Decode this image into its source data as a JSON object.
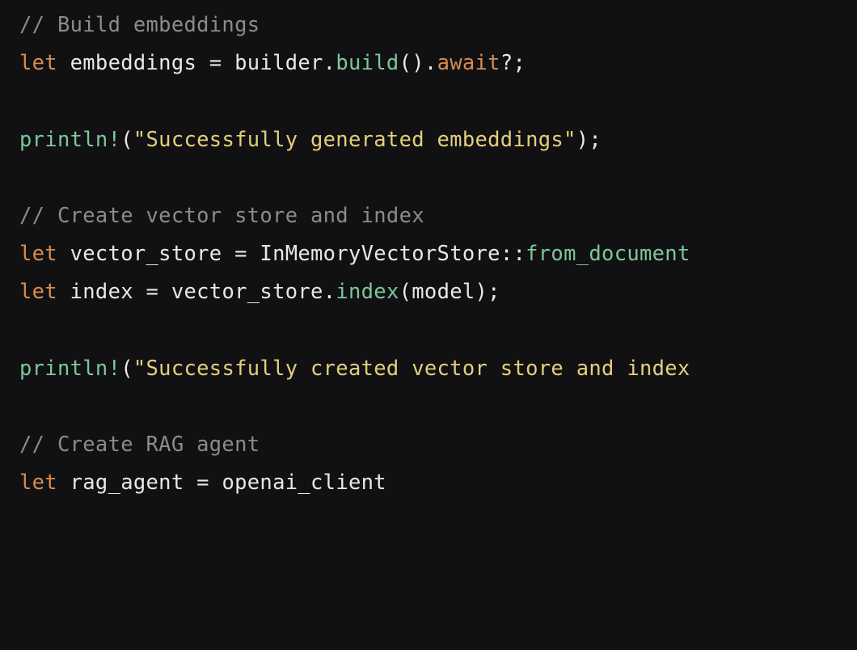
{
  "code": {
    "lines": [
      {
        "tokens": [
          {
            "cls": "tok-comment",
            "text": "// Build embeddings"
          }
        ]
      },
      {
        "tokens": [
          {
            "cls": "tok-keyword",
            "text": "let"
          },
          {
            "cls": "tok-ident",
            "text": " embeddings "
          },
          {
            "cls": "tok-op",
            "text": "="
          },
          {
            "cls": "tok-ident",
            "text": " builder"
          },
          {
            "cls": "tok-punct",
            "text": "."
          },
          {
            "cls": "tok-method",
            "text": "build"
          },
          {
            "cls": "tok-punct",
            "text": "()."
          },
          {
            "cls": "tok-keyword",
            "text": "await"
          },
          {
            "cls": "tok-punct",
            "text": "?;"
          }
        ]
      },
      {
        "tokens": [
          {
            "cls": "tok-ident",
            "text": ""
          }
        ]
      },
      {
        "tokens": [
          {
            "cls": "tok-macro",
            "text": "println!"
          },
          {
            "cls": "tok-punct",
            "text": "("
          },
          {
            "cls": "tok-string",
            "text": "\"Successfully generated embeddings\""
          },
          {
            "cls": "tok-punct",
            "text": ");"
          }
        ]
      },
      {
        "tokens": [
          {
            "cls": "tok-ident",
            "text": ""
          }
        ]
      },
      {
        "tokens": [
          {
            "cls": "tok-comment",
            "text": "// Create vector store and index"
          }
        ]
      },
      {
        "tokens": [
          {
            "cls": "tok-keyword",
            "text": "let"
          },
          {
            "cls": "tok-ident",
            "text": " vector_store "
          },
          {
            "cls": "tok-op",
            "text": "="
          },
          {
            "cls": "tok-type",
            "text": " InMemoryVectorStore"
          },
          {
            "cls": "tok-punct",
            "text": "::"
          },
          {
            "cls": "tok-path",
            "text": "from_document"
          }
        ]
      },
      {
        "tokens": [
          {
            "cls": "tok-keyword",
            "text": "let"
          },
          {
            "cls": "tok-ident",
            "text": " index "
          },
          {
            "cls": "tok-op",
            "text": "="
          },
          {
            "cls": "tok-ident",
            "text": " vector_store"
          },
          {
            "cls": "tok-punct",
            "text": "."
          },
          {
            "cls": "tok-method",
            "text": "index"
          },
          {
            "cls": "tok-punct",
            "text": "(model);"
          }
        ]
      },
      {
        "tokens": [
          {
            "cls": "tok-ident",
            "text": ""
          }
        ]
      },
      {
        "tokens": [
          {
            "cls": "tok-macro",
            "text": "println!"
          },
          {
            "cls": "tok-punct",
            "text": "("
          },
          {
            "cls": "tok-string",
            "text": "\"Successfully created vector store and index"
          }
        ]
      },
      {
        "tokens": [
          {
            "cls": "tok-ident",
            "text": ""
          }
        ]
      },
      {
        "tokens": [
          {
            "cls": "tok-comment",
            "text": "// Create RAG agent"
          }
        ]
      },
      {
        "tokens": [
          {
            "cls": "tok-keyword",
            "text": "let"
          },
          {
            "cls": "tok-ident",
            "text": " rag_agent "
          },
          {
            "cls": "tok-op",
            "text": "="
          },
          {
            "cls": "tok-ident",
            "text": " openai_client"
          }
        ]
      }
    ]
  }
}
